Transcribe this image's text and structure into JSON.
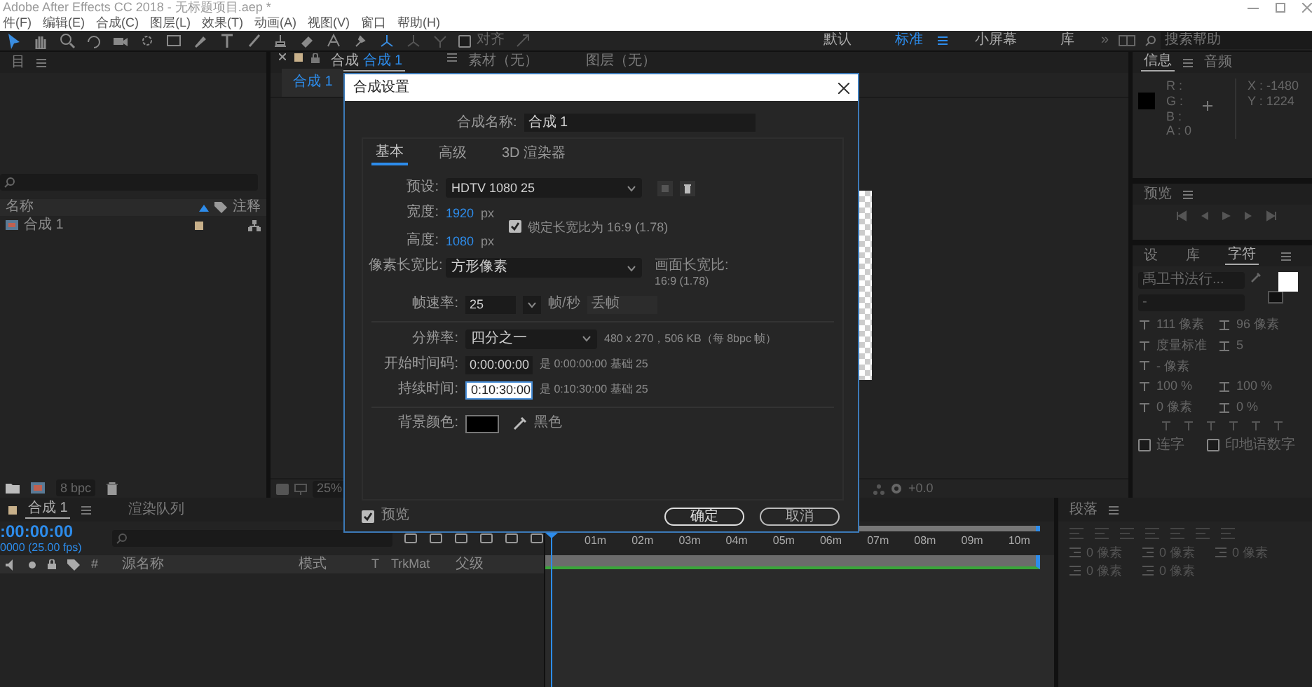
{
  "window": {
    "title": "Adobe After Effects CC 2018 - 无标题项目.aep *"
  },
  "menu": [
    "件(F)",
    "编辑(E)",
    "合成(C)",
    "图层(L)",
    "效果(T)",
    "动画(A)",
    "视图(V)",
    "窗口",
    "帮助(H)"
  ],
  "toolbar": {
    "snap": {
      "label": "对齐",
      "checked": false
    },
    "workspaces": [
      {
        "label": "默认",
        "selected": false
      },
      {
        "label": "标准",
        "selected": true
      },
      {
        "label": "小屏幕",
        "selected": false
      },
      {
        "label": "库",
        "selected": false
      }
    ],
    "more": "»",
    "search": {
      "placeholder": "搜索帮助"
    }
  },
  "project": {
    "title": "目",
    "columns": [
      "名称",
      "注释"
    ],
    "items": [
      {
        "name": "合成 1"
      }
    ],
    "bpc": "8 bpc"
  },
  "comp_viewer": {
    "tabs": [
      {
        "prefix": "合成",
        "label": "合成 1",
        "selected": true
      },
      {
        "label": "素材（无）",
        "selected": false
      },
      {
        "label": "图层（无）",
        "selected": false
      }
    ],
    "breadcrumb": "合成 1",
    "zoom": "25%",
    "exposure": "+0.0"
  },
  "info": {
    "tabs": [
      {
        "label": "信息",
        "selected": true
      },
      {
        "label": "音频",
        "selected": false
      }
    ],
    "channels": [
      "R :",
      "G :",
      "B :",
      "A : 0"
    ],
    "coords": [
      "X : -1480",
      "Y : 1224"
    ]
  },
  "preview": {
    "title": "预览"
  },
  "character": {
    "tabs": [
      {
        "label": "设",
        "selected": false
      },
      {
        "label": "库",
        "selected": false
      },
      {
        "label": "字符",
        "selected": true
      }
    ],
    "font": "禹卫书法行...",
    "style": "-",
    "size": "111 像素",
    "leading": "96 像素",
    "kerning": "度量标准",
    "tracking": "5",
    "stroke": "- 像素",
    "vscale": "100 %",
    "hscale": "100 %",
    "baseline": "0 像素",
    "tsume": "0 %",
    "options": [
      {
        "label": "连字",
        "checked": false
      },
      {
        "label": "印地语数字",
        "checked": false
      }
    ]
  },
  "paragraph": {
    "title": "段落",
    "indents": [
      "0 像素",
      "0 像素",
      "0 像素",
      "0 像素",
      "0 像素"
    ]
  },
  "timeline": {
    "tabs": [
      {
        "label": "合成 1",
        "selected": true
      },
      {
        "label": "渲染队列",
        "selected": false
      }
    ],
    "timecode": ":00:00:00",
    "fps": "0000 (25.00 fps)",
    "columns": [
      "#",
      "源名称",
      "模式",
      "T",
      "TrkMat",
      "父级"
    ],
    "ruler": [
      "01m",
      "02m",
      "03m",
      "04m",
      "05m",
      "06m",
      "07m",
      "08m",
      "09m",
      "10m"
    ]
  },
  "dialog": {
    "title": "合成设置",
    "name_label": "合成名称:",
    "name": "合成 1",
    "tabs": [
      {
        "label": "基本",
        "selected": true
      },
      {
        "label": "高级",
        "selected": false
      },
      {
        "label": "3D 渲染器",
        "selected": false
      }
    ],
    "preset": {
      "label": "预设:",
      "value": "HDTV 1080 25"
    },
    "width": {
      "label": "宽度:",
      "value": "1920",
      "unit": "px"
    },
    "height": {
      "label": "高度:",
      "value": "1080",
      "unit": "px"
    },
    "lock_aspect": {
      "label": "锁定长宽比为 16:9 (1.78)",
      "checked": true
    },
    "pixel_aspect": {
      "label": "像素长宽比:",
      "value": "方形像素"
    },
    "frame_aspect": {
      "label": "画面长宽比:",
      "value": "16:9 (1.78)"
    },
    "frame_rate": {
      "label": "帧速率:",
      "value": "25",
      "unit": "帧/秒",
      "drop": "丢帧"
    },
    "resolution": {
      "label": "分辨率:",
      "value": "四分之一",
      "info": "480 x 270，506 KB（每 8bpc 帧）"
    },
    "start": {
      "label": "开始时间码:",
      "value": "0:00:00:00",
      "info": "是 0:00:00:00 基础 25"
    },
    "duration": {
      "label": "持续时间:",
      "value": "0:10:30:00",
      "info": "是 0:10:30:00 基础 25"
    },
    "background": {
      "label": "背景颜色:",
      "color": "#000000",
      "name": "黑色"
    },
    "preview": {
      "label": "预览",
      "checked": true
    },
    "buttons": [
      {
        "label": "确定",
        "kind": "primary"
      },
      {
        "label": "取消",
        "kind": "secondary"
      }
    ]
  }
}
